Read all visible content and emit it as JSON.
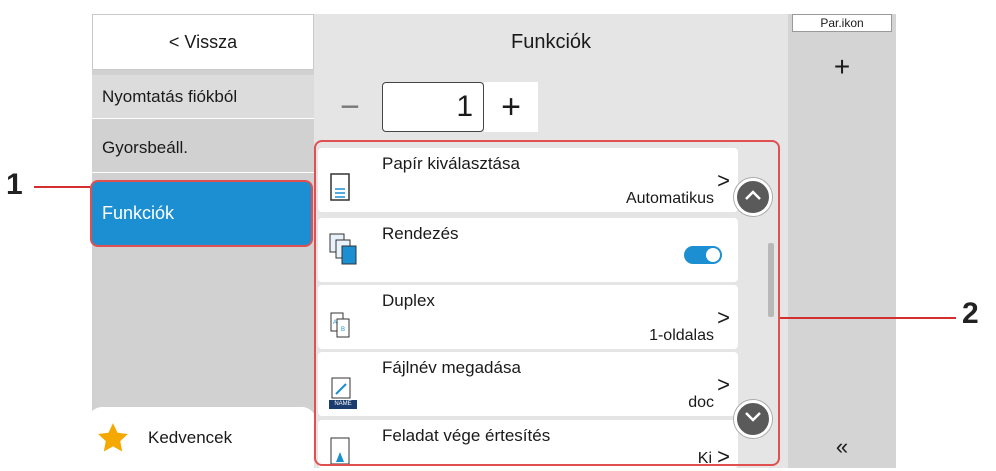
{
  "nav": {
    "back_label": "< Vissza",
    "items": [
      {
        "label": "Nyomtatás fiókból"
      },
      {
        "label": "Gyorsbeáll."
      },
      {
        "label": "Funkciók"
      }
    ],
    "favorites_label": "Kedvencek"
  },
  "main": {
    "title": "Funkciók",
    "copies": {
      "minus": "−",
      "value": "1",
      "plus": "+"
    },
    "functions": [
      {
        "label": "Papír kiválasztása",
        "value": "Automatikus",
        "chevron": ">",
        "icon": "paper-icon"
      },
      {
        "label": "Rendezés",
        "value": "",
        "toggle_on": true,
        "icon": "collate-icon"
      },
      {
        "label": "Duplex",
        "value": "1-oldalas",
        "chevron": ">",
        "icon": "duplex-icon"
      },
      {
        "label": "Fájlnév megadása",
        "value": "doc",
        "chevron": ">",
        "icon": "filename-icon",
        "icon_text": "NAME"
      },
      {
        "label": "Feladat vége értesítés",
        "value": "Ki",
        "chevron": ">",
        "icon": "notification-icon"
      }
    ]
  },
  "right": {
    "shortcut_label": "Par.ikon",
    "add_symbol": "+",
    "collapse_symbol": "«"
  },
  "callouts": {
    "one": "1",
    "two": "2"
  },
  "colors": {
    "accent": "#1b8fd2",
    "callout": "#d32f2f",
    "star": "#f5a800"
  }
}
